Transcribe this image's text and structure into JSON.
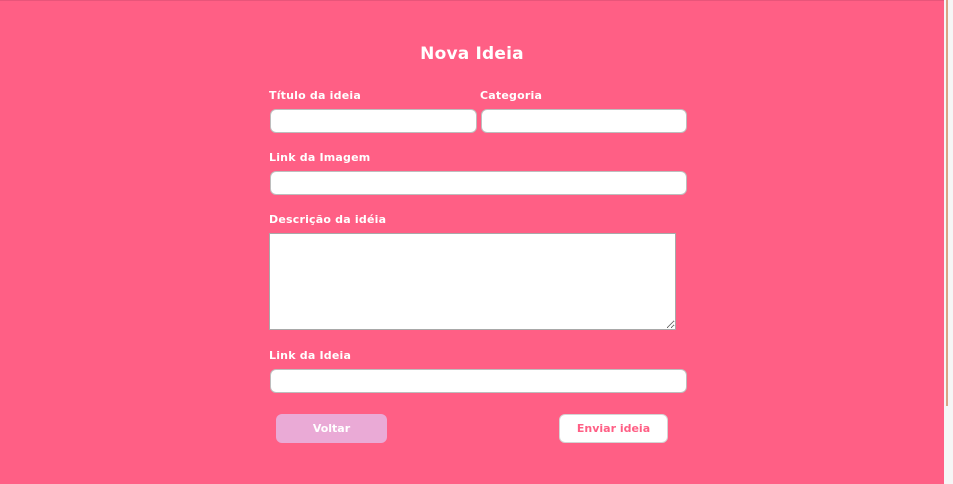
{
  "form": {
    "title": "Nova Ideia",
    "fields": {
      "idea_title": {
        "label": "Título da ideia",
        "value": "",
        "placeholder": ""
      },
      "category": {
        "label": "Categoria",
        "value": "",
        "placeholder": ""
      },
      "image_link": {
        "label": "Link da Imagem",
        "value": "",
        "placeholder": ""
      },
      "description": {
        "label": "Descrição da idéia",
        "value": "",
        "placeholder": ""
      },
      "idea_link": {
        "label": "Link da Ideia",
        "value": "",
        "placeholder": ""
      }
    },
    "buttons": {
      "back_label": "Voltar",
      "submit_label": "Enviar ideia"
    }
  },
  "colors": {
    "background": "#ff5f85",
    "back_button": "#eaaad6",
    "submit_text": "#ff5f85",
    "text": "#ffffff"
  }
}
